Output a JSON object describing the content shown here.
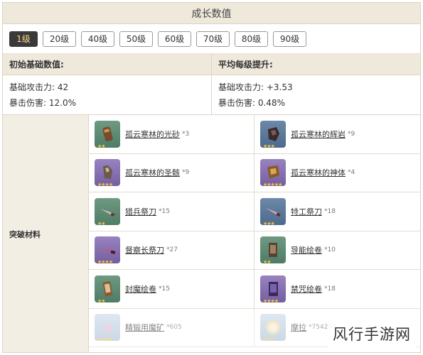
{
  "title": "成长数值",
  "levels": [
    "1级",
    "20级",
    "40级",
    "50级",
    "60级",
    "70级",
    "80级",
    "90级"
  ],
  "active_level": "1级",
  "stats": {
    "base_header": "初始基础数值:",
    "growth_header": "平均每级提升:",
    "base": [
      "基础攻击力: 42",
      "暴击伤害: 12.0%"
    ],
    "growth": [
      "基础攻击力: +3.53",
      "暴击伤害: 0.48%"
    ]
  },
  "materials_label": "突破材料",
  "materials": [
    {
      "name": "孤云寒林的光砂",
      "count": "*3",
      "icon": "sand-icon",
      "rarity": "green",
      "stars": "★★"
    },
    {
      "name": "孤云寒林的辉岩",
      "count": "*9",
      "icon": "rock-icon",
      "rarity": "blue",
      "stars": "★★★"
    },
    {
      "name": "孤云寒林的圣骸",
      "count": "*9",
      "icon": "relic-icon",
      "rarity": "purple",
      "stars": "★★★★"
    },
    {
      "name": "孤云寒林的神体",
      "count": "*4",
      "icon": "divine-body-icon",
      "rarity": "purple",
      "stars": "★★★★★"
    },
    {
      "name": "猎兵祭刀",
      "count": "*15",
      "icon": "hunter-knife-icon",
      "rarity": "green",
      "stars": "★★"
    },
    {
      "name": "特工祭刀",
      "count": "*18",
      "icon": "agent-knife-icon",
      "rarity": "blue",
      "stars": "★★★"
    },
    {
      "name": "督察长祭刀",
      "count": "*27",
      "icon": "inspector-knife-icon",
      "rarity": "purple",
      "stars": "★★★★"
    },
    {
      "name": "导能绘卷",
      "count": "*10",
      "icon": "scroll-icon",
      "rarity": "green",
      "stars": "★★"
    },
    {
      "name": "封魔绘卷",
      "count": "*15",
      "icon": "sealed-scroll-icon",
      "rarity": "green",
      "stars": "★★"
    },
    {
      "name": "禁咒绘卷",
      "count": "*18",
      "icon": "forbidden-scroll-icon",
      "rarity": "purple",
      "stars": "★★★★"
    },
    {
      "name": "精锻用魔矿",
      "count": "*605",
      "icon": "ore-icon",
      "rarity": "pale",
      "stars": "★★★★"
    },
    {
      "name": "摩拉",
      "count": "*754265",
      "icon": "mora-coin-icon",
      "rarity": "pale",
      "stars": "★★★"
    }
  ],
  "watermark": "风行手游网"
}
